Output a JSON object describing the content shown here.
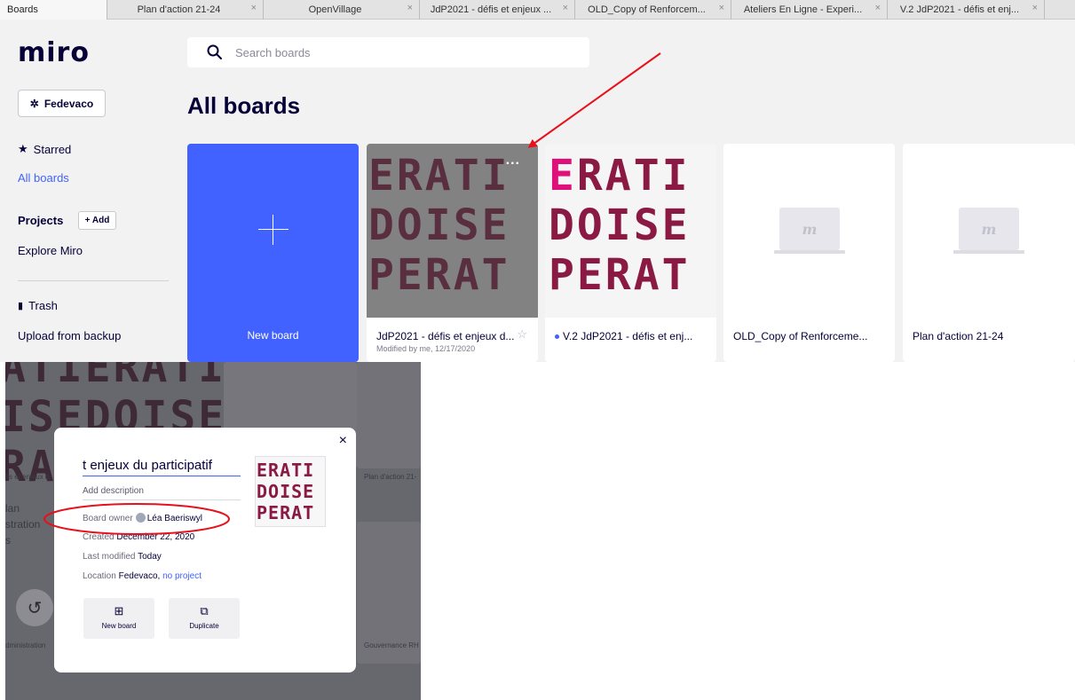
{
  "browser_tabs": [
    {
      "label": "Boards",
      "active": true
    },
    {
      "label": "Plan d'action 21-24"
    },
    {
      "label": "OpenVillage"
    },
    {
      "label": "JdP2021 - défis et enjeux ..."
    },
    {
      "label": "OLD_Copy of Renforcem..."
    },
    {
      "label": "Ateliers En Ligne - Experi..."
    },
    {
      "label": "V.2 JdP2021 - défis et enj..."
    }
  ],
  "tab_close_glyph": "×",
  "logo": "miro",
  "search": {
    "placeholder": "Search boards"
  },
  "team": {
    "name": "Fedevaco"
  },
  "sidebar": {
    "starred": "Starred",
    "all_boards": "All boards",
    "projects": "Projects",
    "add_label": "+ Add",
    "explore": "Explore Miro",
    "trash": "Trash",
    "upload": "Upload from backup"
  },
  "page_title": "All boards",
  "boards": {
    "new_board_label": "New board",
    "cards": [
      {
        "title": "JdP2021 - défis et enjeux d...",
        "subtitle": "Modified by me, 12/17/2020",
        "menu": "..."
      },
      {
        "title": "V.2 JdP2021 - défis et enj..."
      },
      {
        "title": "OLD_Copy of Renforceme..."
      },
      {
        "title": "Plan d'action 21-24"
      }
    ],
    "thumb_art": {
      "line1_hot": "E",
      "line1": "RATI",
      "line1_prefix": "ERATI",
      "line2": "DOISE",
      "line3": "PERAT"
    },
    "placeholder_glyph": "m"
  },
  "background_crop": {
    "art_line1": "ATIERATI",
    "art_line2": "ISEDOISE",
    "art_line3": "RA",
    "text_card_left": "fis et enjeux d",
    "text_card_right_top": "Plan d'action 21-",
    "text_left_plan": "lan\nstration\ns",
    "text_admin": "dministration",
    "text_gouvernance": "Gouvernance RH"
  },
  "modal": {
    "close": "×",
    "title": "t enjeux du participatif",
    "description_placeholder": "Add description",
    "owner_label": "Board owner",
    "owner_name": "Léa Baeriswyl",
    "created_label": "Created",
    "created_value": "December 22, 2020",
    "modified_label": "Last modified",
    "modified_value": "Today",
    "location_label": "Location",
    "location_value": "Fedevaco,",
    "location_link": "no project",
    "actions": [
      {
        "label": "New board",
        "icon": "plus-square-icon"
      },
      {
        "label": "Duplicate",
        "icon": "duplicate-icon"
      }
    ]
  },
  "colors": {
    "brand_blue": "#4262ff",
    "art_dark": "#8a1a44",
    "art_hot": "#e0107a",
    "annotation_red": "#e8101a"
  }
}
